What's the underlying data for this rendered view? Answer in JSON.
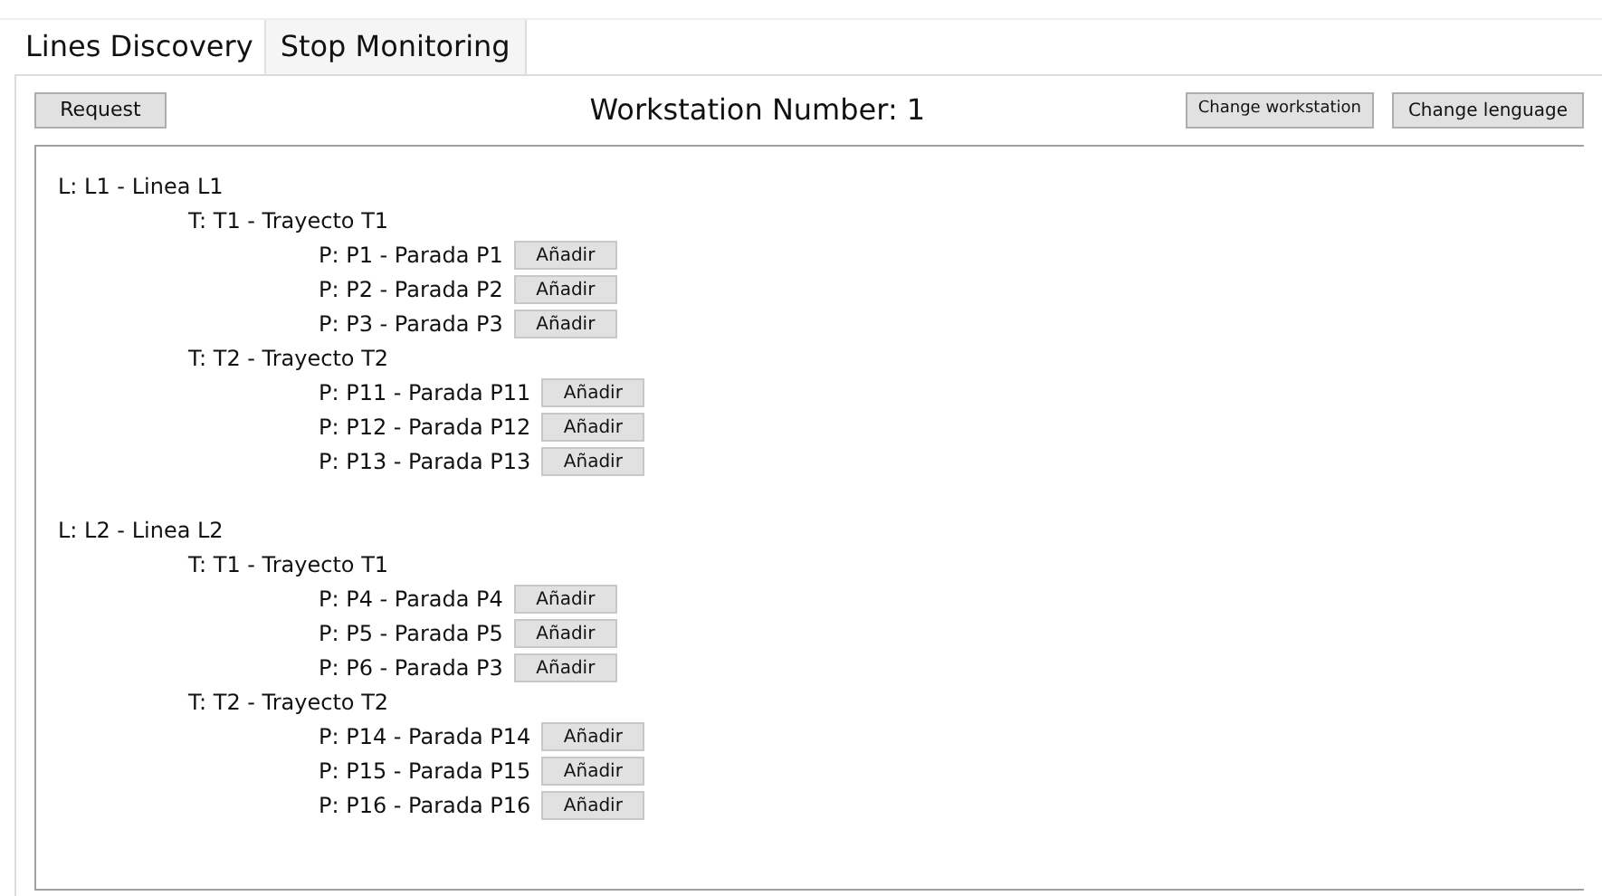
{
  "tabs": [
    {
      "label": "Lines Discovery",
      "selected": true
    },
    {
      "label": "Stop Monitoring",
      "selected": false
    }
  ],
  "toolbar": {
    "request_button": "Request",
    "workstation_label": "Workstation Number: 1",
    "buttons": [
      "Change workstation",
      "Change lenguage"
    ]
  },
  "tree": [
    {
      "label": "L: L1 - Linea L1",
      "children": [
        {
          "label": "T: T1 - Trayecto T1",
          "children": [
            {
              "label": "P: P1 - Parada P1",
              "button": "Añadir"
            },
            {
              "label": "P: P2 - Parada P2",
              "button": "Añadir"
            },
            {
              "label": "P: P3 - Parada P3",
              "button": "Añadir"
            }
          ]
        },
        {
          "label": "T: T2 - Trayecto T2",
          "children": [
            {
              "label": "P: P11 - Parada P11",
              "button": "Añadir"
            },
            {
              "label": "P: P12 - Parada P12",
              "button": "Añadir"
            },
            {
              "label": "P: P13 - Parada P13",
              "button": "Añadir"
            }
          ]
        }
      ]
    },
    {
      "label": "L: L2 - Linea L2",
      "children": [
        {
          "label": "T: T1 - Trayecto T1",
          "children": [
            {
              "label": "P: P4 - Parada P4",
              "button": "Añadir"
            },
            {
              "label": "P: P5 - Parada P5",
              "button": "Añadir"
            },
            {
              "label": "P: P6 - Parada P3",
              "button": "Añadir"
            }
          ]
        },
        {
          "label": "T: T2 - Trayecto T2",
          "children": [
            {
              "label": "P: P14 - Parada P14",
              "button": "Añadir"
            },
            {
              "label": "P: P15 - Parada P15",
              "button": "Añadir"
            },
            {
              "label": "P: P16 - Parada P16",
              "button": "Añadir"
            }
          ]
        }
      ]
    }
  ]
}
